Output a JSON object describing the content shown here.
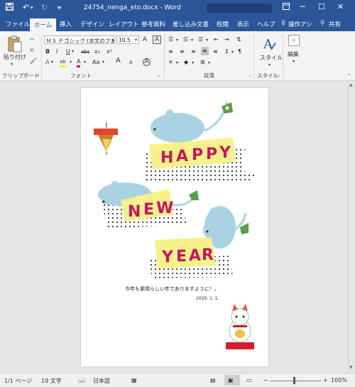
{
  "titlebar": {
    "title": "24754_nenga_eto.docx  -  Word",
    "save_icon": "save-icon",
    "undo_icon": "undo-icon",
    "redo_icon": "redo-icon",
    "minimize": "─",
    "restore": "☐",
    "close": "✕"
  },
  "tabs": {
    "file": "ファイル",
    "home": "ホーム",
    "insert": "挿入",
    "design": "デザイン",
    "layout": "レイアウト",
    "references": "参考資料",
    "mailings": "差し込み文書",
    "review": "校閲",
    "view": "表示",
    "help": "ヘルプ",
    "tellme": "操作アシ",
    "share": "共有"
  },
  "ribbon": {
    "clipboard": {
      "paste": "貼り付け",
      "label": "クリップボード"
    },
    "font": {
      "name": "ＭＳ Ｐゴシック (本文のフォ",
      "size": "10.5",
      "label": "フォント",
      "size_up": "A",
      "size_down": "A",
      "clear": "A",
      "bold": "B",
      "italic": "I",
      "underline": "U",
      "strike": "abc",
      "sub": "x₂",
      "sup": "x²",
      "effect": "A",
      "highlight": "ab",
      "fontcolor": "A",
      "case": "Aa",
      "grow": "A",
      "shrink": "A",
      "phonetic": "A",
      "enclose": "A"
    },
    "paragraph": {
      "label": "段落"
    },
    "styles": {
      "button": "スタイル",
      "label": "スタイル"
    },
    "editing": {
      "button": "編集"
    }
  },
  "document": {
    "greeting": "今年も素晴らしい年でありますように！。",
    "date": "2020. 1. 1.",
    "happy": [
      "H",
      "A",
      "P",
      "P",
      "Y"
    ],
    "new": [
      "N",
      "E",
      "W"
    ],
    "year": [
      "Y",
      "E",
      "A",
      "R"
    ]
  },
  "status": {
    "page": "1/1 ページ",
    "words": "19 文字",
    "language": "日本語",
    "zoom": "100%"
  },
  "colors": {
    "word_blue": "#2b579a",
    "ribbon_bg": "#f3f3f3",
    "banner_yellow": "#f6f18b",
    "mouse_blue": "#a9d3e3",
    "text_magenta": "#c4175f"
  }
}
